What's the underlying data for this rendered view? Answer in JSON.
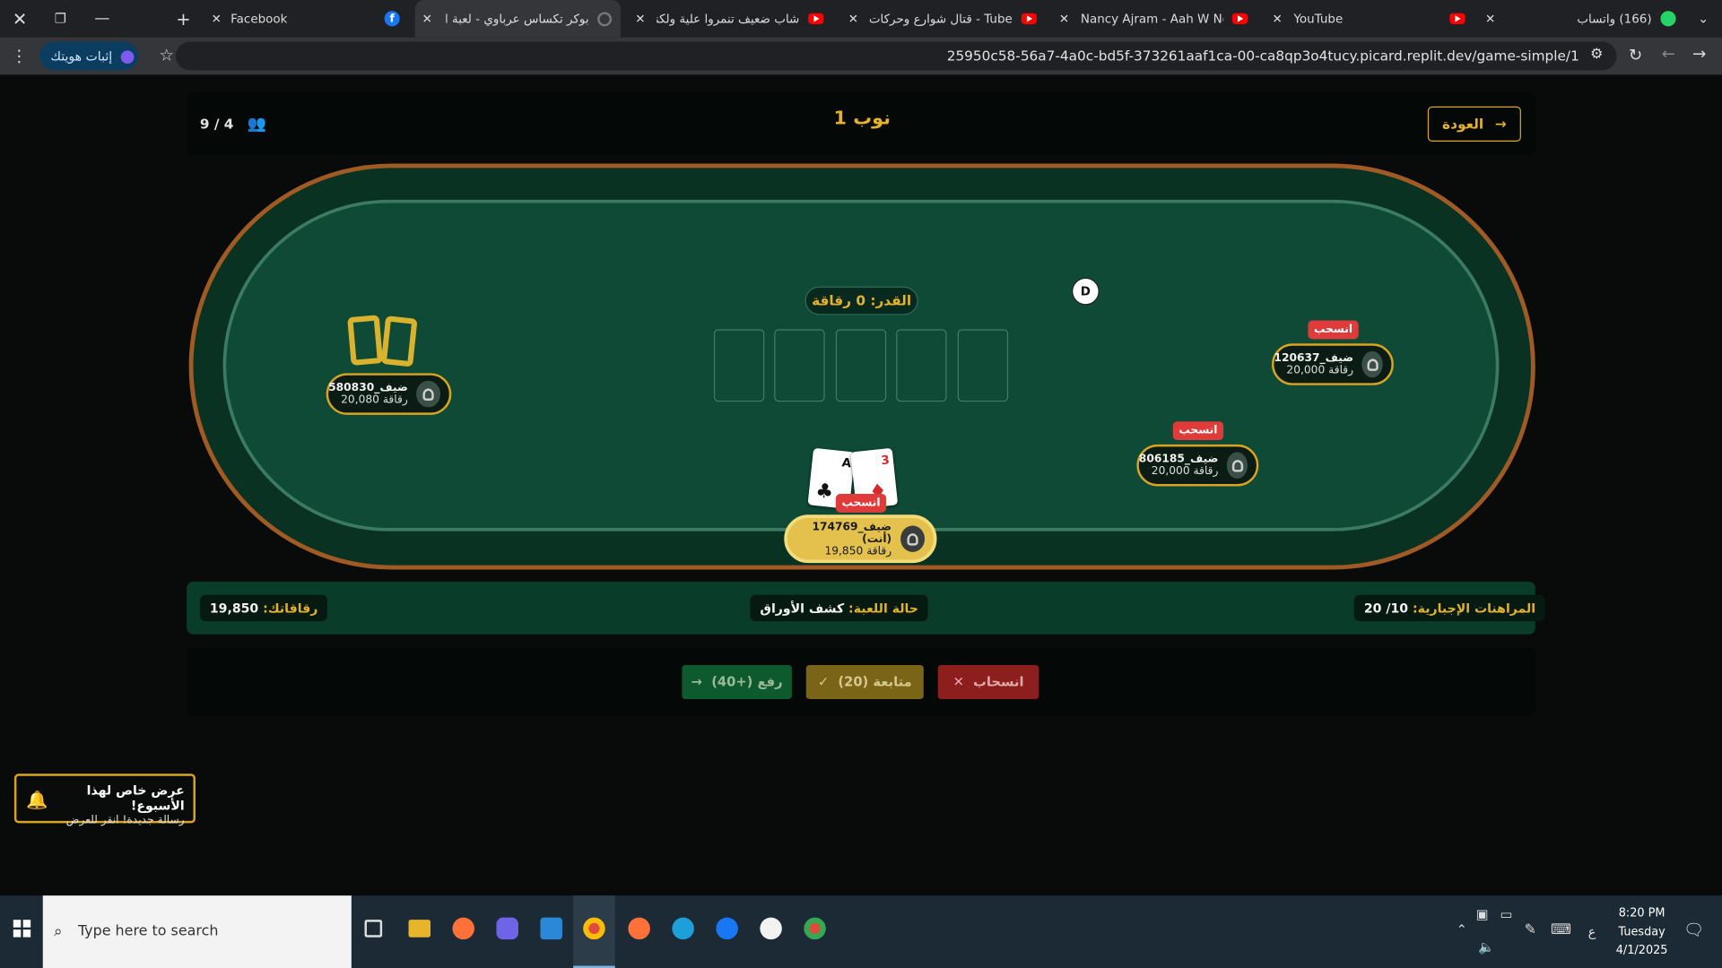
{
  "browser": {
    "tabs": [
      {
        "title": "Facebook",
        "icon": "facebook-icon"
      },
      {
        "title": "بوكر تكساس عرباوي - لعبة البوكر",
        "icon": "replit-icon",
        "active": true
      },
      {
        "title": "شاب ضعيف تنمروا علية ولكنهم لا",
        "icon": "youtube-icon"
      },
      {
        "title": "Tube - قتال شوارع وحركات انمي",
        "icon": "youtube-icon"
      },
      {
        "title": "Nancy Ajram - Aah W Noss - Yo",
        "icon": "youtube-icon"
      },
      {
        "title": "YouTube",
        "icon": "youtube-icon"
      },
      {
        "title": "(166) واتساب",
        "icon": "whatsapp-icon"
      }
    ],
    "identity_label": "إثبات هويتك",
    "url": "25950c58-56a7-4a0c-bd5f-373261aaf1ca-00-ca8qp3o4tucy.picard.replit.dev/game-simple/1"
  },
  "header": {
    "back_label": "العودة",
    "title": "نوب 1",
    "players": "9 / 4"
  },
  "pot_label": "القدر: 0 رقاقة",
  "dealer_label": "D",
  "players": [
    {
      "name": "ضيف_580830",
      "chips": "20,080 رقاقة"
    },
    {
      "name": "ضيف_120637",
      "chips": "20,000 رقاقة",
      "status": "انسحب"
    },
    {
      "name": "ضيف_806185",
      "chips": "20,000 رقاقة",
      "status": "انسحب"
    },
    {
      "name": "ضيف_174769  (أنت)",
      "chips": "19,850 رقاقة",
      "status": "انسحب"
    }
  ],
  "hand": [
    {
      "rank": "A",
      "suit": "♣",
      "color": "#111111"
    },
    {
      "rank": "3",
      "suit": "♦",
      "color": "#d42a2a"
    }
  ],
  "status": {
    "chips_key": "رقاقاتك:",
    "chips_val": "19,850",
    "state_key": "حالة اللعبة:",
    "state_val": "كشف الأوراق",
    "blinds_key": "المراهنات الإجبارية:",
    "blinds_val": "10/ 20"
  },
  "actions": {
    "raise": "رفع (+40)",
    "call": "متابعة (20)",
    "fold": "انسحاب"
  },
  "promo": {
    "title": "عرض خاص لهذا الأسبوع!",
    "subtitle": "رسالة جديدة! انقر للعرض"
  },
  "taskbar": {
    "search_placeholder": "Type here to search",
    "ime": "ع",
    "time": "8:20 PM",
    "day": "Tuesday",
    "date": "4/1/2025"
  },
  "colors": {
    "gold": "#e3b22c",
    "felt": "#0e4a35",
    "rim": "#a05a23",
    "fold_red": "#e03b3b"
  }
}
